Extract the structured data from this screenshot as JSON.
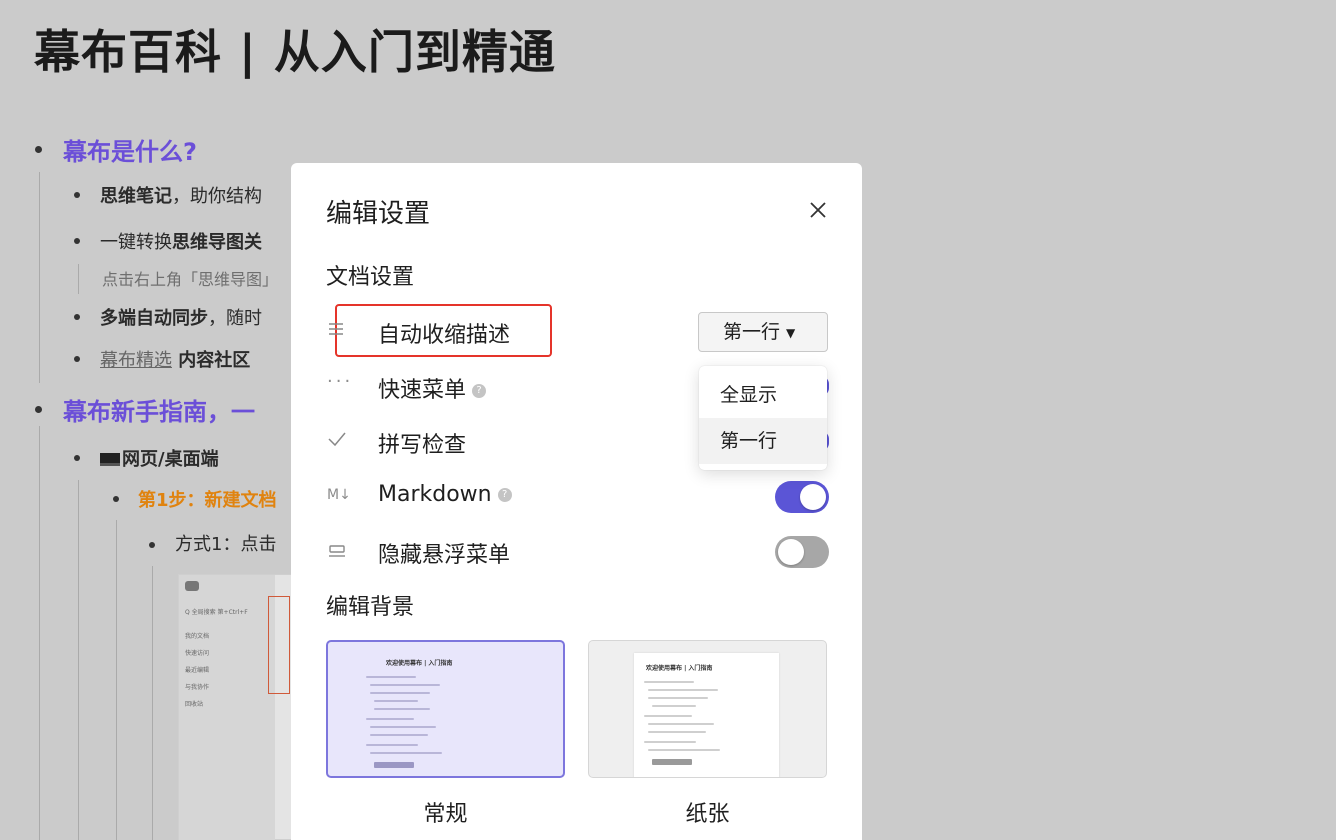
{
  "document": {
    "title": "幕布百科 | 从入门到精通",
    "items": [
      {
        "text": "幕布是什么?"
      },
      {
        "text_bold": "思维笔记",
        "text": "，助你结构"
      },
      {
        "text": "一键转换",
        "text_bold": "思维导图关"
      },
      {
        "text": "点击右上角「思维导图」"
      },
      {
        "text_bold": "多端自动同步",
        "text": "，随时"
      },
      {
        "link": "幕布精选",
        "text_bold": " 内容社区"
      },
      {
        "text": "幕布新手指南，一"
      },
      {
        "text": "网页/桌面端"
      },
      {
        "text": "第1步：新建文档"
      },
      {
        "text": "方式1：点击"
      }
    ],
    "mini_sidebar": [
      "Q 全局搜索 第+Ctrl+F",
      "我的文档",
      "快速访问",
      "最近编辑",
      "与我协作",
      "回收站"
    ]
  },
  "modal": {
    "title": "编辑设置",
    "close_icon": "close-icon",
    "doc_settings_heading": "文档设置",
    "rows": [
      {
        "icon": "collapse-lines-icon",
        "label": "自动收缩描述",
        "control": "select",
        "value": "第一行"
      },
      {
        "icon": "ellipsis-icon",
        "label": "快速菜单",
        "help": true,
        "control": "toggle",
        "on": true
      },
      {
        "icon": "checkmark-icon",
        "label": "拼写检查",
        "control": "toggle",
        "on": true
      },
      {
        "icon": "markdown-icon",
        "label": "Markdown",
        "help": true,
        "control": "toggle",
        "on": true
      },
      {
        "icon": "hover-menu-icon",
        "label": "隐藏悬浮菜单",
        "control": "toggle",
        "on": false
      }
    ],
    "dropdown_options": [
      "全显示",
      "第一行"
    ],
    "background_heading": "编辑背景",
    "backgrounds": [
      {
        "label": "常规",
        "selected": true,
        "thumb_title": "欢迎使用幕布 | 入门指南"
      },
      {
        "label": "纸张",
        "selected": false,
        "thumb_title": "欢迎使用幕布 | 入门指南"
      }
    ],
    "colors": {
      "accent": "#5b55d6",
      "highlight": "#e5342a",
      "toggle_off": "#a7a7a7"
    }
  }
}
